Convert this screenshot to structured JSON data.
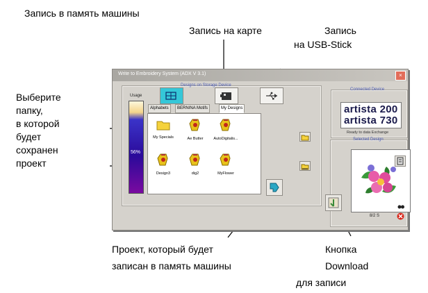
{
  "annotations": {
    "write_memory": "Запись в память машины",
    "write_card": "Запись на карте",
    "write_usb_1": "Запись",
    "write_usb_2": "на USB-Stick",
    "choose_folder": [
      "Выберите",
      "папку,",
      "в которой",
      "будет",
      "сохранен",
      "проект"
    ],
    "design_note": [
      "Проект, который будет",
      "записан в память машины"
    ],
    "download_note": [
      "Кнопка",
      "Download",
      "для записи"
    ]
  },
  "window": {
    "title": "Write to Embroidery System (ADX V 3.1)",
    "close_label": "×",
    "storage_group_label": "Designs on Storage Device",
    "usage_label": "Usage",
    "usage_percent": "56%",
    "usage_value": 0.56,
    "tabs": [
      "Alphabets",
      "BERNINA Motifs",
      "My Designs"
    ],
    "active_tab": "My Designs",
    "folders": [
      {
        "label": "My Specials",
        "icon": "folder-icon"
      },
      {
        "label": "Ae Butter",
        "icon": "design-file-icon"
      },
      {
        "label": "AutoDigitalis...",
        "icon": "design-file-icon"
      },
      {
        "label": "Design3",
        "icon": "design-file-icon"
      },
      {
        "label": "dig2",
        "icon": "design-file-icon"
      },
      {
        "label": "MyFlower",
        "icon": "design-file-icon"
      }
    ],
    "connected_label": "Connected Device",
    "machine_line1": "artista 200",
    "machine_line2": "artista 730",
    "ready_text": "Ready to data Exchange",
    "selected_label": "Selected Design",
    "design_counter": "8/2 S",
    "colors": {
      "accent": "#35c7d8",
      "title": "#4a5ab5"
    }
  }
}
